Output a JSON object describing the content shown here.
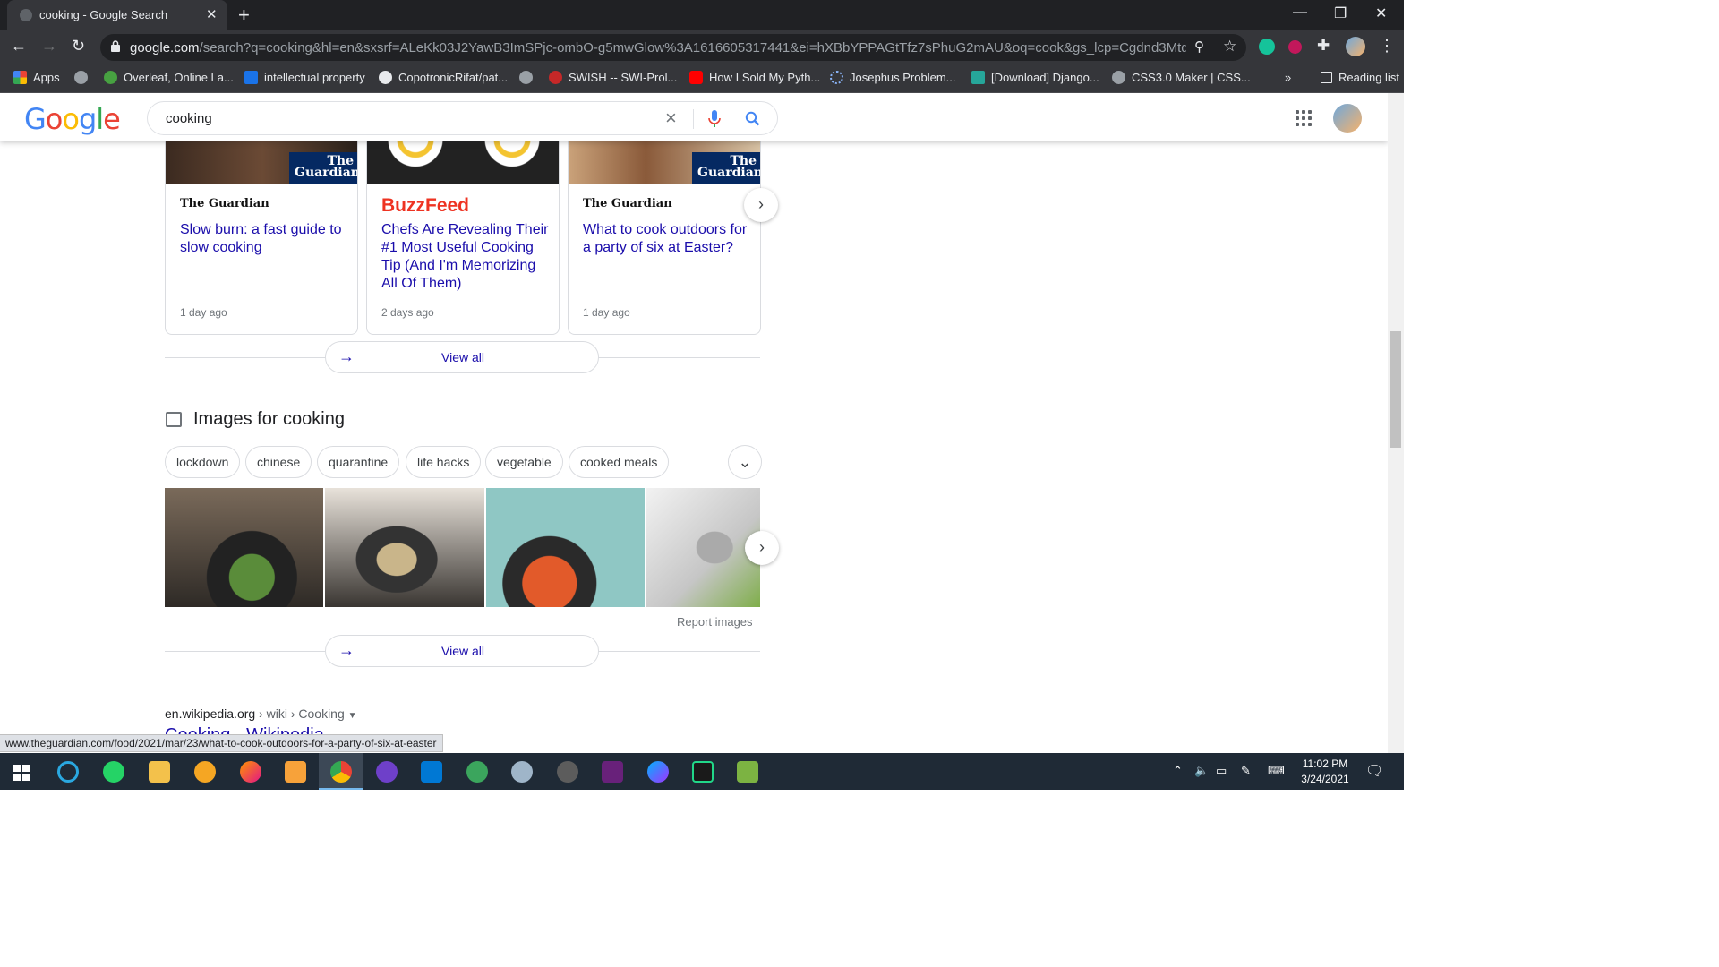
{
  "browser": {
    "tab_title": "cooking - Google Search",
    "url_domain": "google.com",
    "url_rest": "/search?q=cooking&hl=en&sxsrf=ALeKk03J2YawB3ImSPjc-ombO-g5mwGlow%3A1616605317441&ei=hXBbYPPAGtTfz7sPhuG2mAU&oq=cook&gs_lcp=Cgdnd3Mtd2l6EAM...",
    "bookmarks": [
      {
        "label": "Apps",
        "color": "#ea4335"
      },
      {
        "label": "",
        "color": "#9aa0a6"
      },
      {
        "label": "Overleaf, Online La...",
        "color": "#47a141"
      },
      {
        "label": "intellectual property",
        "color": "#1a73e8"
      },
      {
        "label": "CopotronicRifat/pat...",
        "color": "#e8eaed"
      },
      {
        "label": "",
        "color": "#9aa0a6"
      },
      {
        "label": "SWISH -- SWI-Prol...",
        "color": "#c62828"
      },
      {
        "label": "How I Sold My Pyth...",
        "color": "#ff0000"
      },
      {
        "label": "Josephus Problem...",
        "color": "#3949ab"
      },
      {
        "label": "[Download] Django...",
        "color": "#26a69a"
      },
      {
        "label": "CSS3.0 Maker | CSS...",
        "color": "#9aa0a6"
      }
    ],
    "more_bookmarks": "»",
    "reading_list": "Reading list"
  },
  "search": {
    "query": "cooking"
  },
  "news": [
    {
      "publisher": "The Guardian",
      "title": "Slow burn: a fast guide to slow cooking",
      "age": "1 day ago",
      "badge": "The Guardian"
    },
    {
      "publisher": "BuzzFeed",
      "title": "Chefs Are Revealing Their #1 Most Useful Cooking Tip (And I'm Memorizing All Of Them)",
      "age": "2 days ago",
      "badge": ""
    },
    {
      "publisher": "The Guardian",
      "title": "What to cook outdoors for a party of six at Easter?",
      "age": "1 day ago",
      "badge": "The Guardian"
    }
  ],
  "view_all_label": "View all",
  "images": {
    "section_title": "Images for cooking",
    "chips": [
      "lockdown",
      "chinese",
      "quarantine",
      "life hacks",
      "vegetable",
      "cooked meals"
    ],
    "report_label": "Report images"
  },
  "wiki": {
    "domain": "en.wikipedia.org",
    "path": " › wiki › Cooking",
    "title": "Cooking - Wikipedia"
  },
  "status_url": "www.theguardian.com/food/2021/mar/23/what-to-cook-outdoors-for-a-party-of-six-at-easter",
  "taskbar": {
    "time": "11:02 PM",
    "date": "3/24/2021"
  },
  "colors": {
    "link": "#1a0dab",
    "guardian": "#052962",
    "buzzfeed": "#ee3322"
  }
}
